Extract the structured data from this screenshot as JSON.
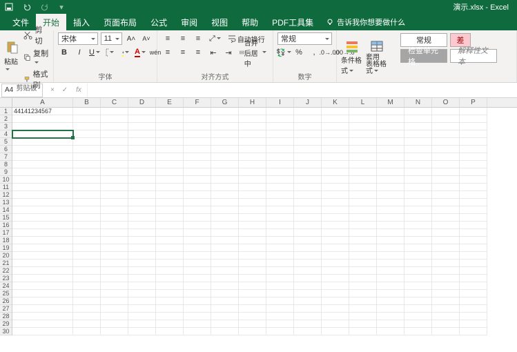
{
  "app": {
    "title": "演示.xlsx - Excel"
  },
  "qat": {
    "save": "save",
    "undo": "undo",
    "redo": "redo"
  },
  "tabs": {
    "file": "文件",
    "home": "开始",
    "insert": "插入",
    "layout": "页面布局",
    "formulas": "公式",
    "review": "审阅",
    "view": "视图",
    "help": "帮助",
    "pdf": "PDF工具集",
    "tellme": "告诉我你想要做什么"
  },
  "ribbon": {
    "clipboard": {
      "cut": "剪切",
      "copy": "复制",
      "painter": "格式刷",
      "paste": "粘贴",
      "label": "剪贴板"
    },
    "font": {
      "name": "宋体",
      "size": "11",
      "bold": "B",
      "italic": "I",
      "underline": "U",
      "label": "字体"
    },
    "align": {
      "wrap": "自动换行",
      "merge": "合并后居中",
      "label": "对齐方式"
    },
    "number": {
      "format": "常规",
      "label": "数字"
    },
    "styles": {
      "cond": "条件格式",
      "table": "套用\n表格格式",
      "normal": "常规",
      "bad": "差",
      "check": "检查单元格",
      "explain": "解释性文本"
    }
  },
  "formula_bar": {
    "name": "A4",
    "fx": "fx",
    "value": ""
  },
  "grid": {
    "columns": [
      "A",
      "B",
      "C",
      "D",
      "E",
      "F",
      "G",
      "H",
      "I",
      "J",
      "K",
      "L",
      "M",
      "N",
      "O",
      "P"
    ],
    "rows": 30,
    "colA_width": 88,
    "other_col_width": 40,
    "data": {
      "A1": "44141234567"
    },
    "selection": "A4"
  }
}
